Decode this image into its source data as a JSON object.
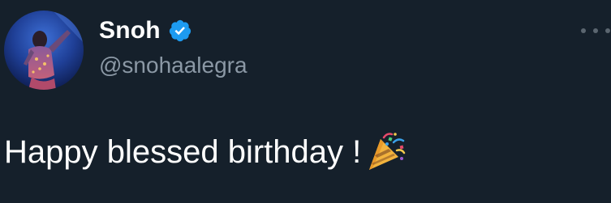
{
  "tweet": {
    "author": {
      "display_name": "Snoh",
      "handle": "@snohaalegra",
      "verified": true,
      "avatar_icon": "profile-photo"
    },
    "text": "Happy blessed birthday !",
    "emoji": "party-popper-icon",
    "more_icon": "more-options-icon"
  },
  "colors": {
    "background": "#15202b",
    "primary_text": "#ffffff",
    "secondary_text": "#8b98a5",
    "verified_blue": "#1d9bf0"
  }
}
